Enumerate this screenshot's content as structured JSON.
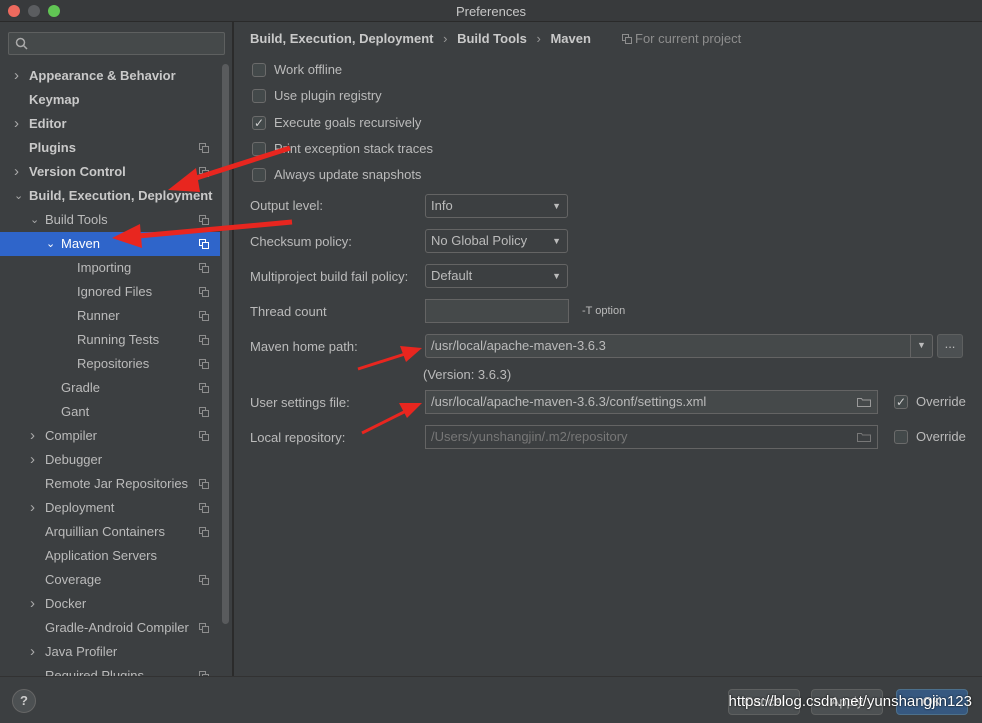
{
  "window": {
    "title": "Preferences"
  },
  "search": {
    "placeholder": ""
  },
  "sidebar": {
    "items": [
      {
        "label": "Appearance & Behavior",
        "bold": true,
        "chevron": "right",
        "copy": false
      },
      {
        "label": "Keymap",
        "bold": true,
        "chevron": "",
        "copy": false
      },
      {
        "label": "Editor",
        "bold": true,
        "chevron": "right",
        "copy": false
      },
      {
        "label": "Plugins",
        "bold": true,
        "chevron": "",
        "copy": true
      },
      {
        "label": "Version Control",
        "bold": true,
        "chevron": "right",
        "copy": true
      },
      {
        "label": "Build, Execution, Deployment",
        "bold": true,
        "chevron": "down",
        "copy": false
      },
      {
        "label": "Build Tools",
        "bold": false,
        "chevron": "down",
        "copy": true
      },
      {
        "label": "Maven",
        "bold": false,
        "chevron": "down",
        "copy": true,
        "selected": true
      },
      {
        "label": "Importing",
        "bold": false,
        "chevron": "",
        "copy": true
      },
      {
        "label": "Ignored Files",
        "bold": false,
        "chevron": "",
        "copy": true
      },
      {
        "label": "Runner",
        "bold": false,
        "chevron": "",
        "copy": true
      },
      {
        "label": "Running Tests",
        "bold": false,
        "chevron": "",
        "copy": true
      },
      {
        "label": "Repositories",
        "bold": false,
        "chevron": "",
        "copy": true
      },
      {
        "label": "Gradle",
        "bold": false,
        "chevron": "",
        "copy": true
      },
      {
        "label": "Gant",
        "bold": false,
        "chevron": "",
        "copy": true
      },
      {
        "label": "Compiler",
        "bold": false,
        "chevron": "right",
        "copy": true
      },
      {
        "label": "Debugger",
        "bold": false,
        "chevron": "right",
        "copy": false
      },
      {
        "label": "Remote Jar Repositories",
        "bold": false,
        "chevron": "",
        "copy": true
      },
      {
        "label": "Deployment",
        "bold": false,
        "chevron": "right",
        "copy": true
      },
      {
        "label": "Arquillian Containers",
        "bold": false,
        "chevron": "",
        "copy": true
      },
      {
        "label": "Application Servers",
        "bold": false,
        "chevron": "",
        "copy": false
      },
      {
        "label": "Coverage",
        "bold": false,
        "chevron": "",
        "copy": true
      },
      {
        "label": "Docker",
        "bold": false,
        "chevron": "right",
        "copy": false
      },
      {
        "label": "Gradle-Android Compiler",
        "bold": false,
        "chevron": "",
        "copy": true
      },
      {
        "label": "Java Profiler",
        "bold": false,
        "chevron": "right",
        "copy": false
      },
      {
        "label": "Required Plugins",
        "bold": false,
        "chevron": "",
        "copy": true
      }
    ]
  },
  "breadcrumb": {
    "part1": "Build, Execution, Deployment",
    "part2": "Build Tools",
    "part3": "Maven",
    "separator": "›"
  },
  "scope_label": "For current project",
  "checkboxes": [
    {
      "label": "Work offline",
      "checked": false
    },
    {
      "label": "Use plugin registry",
      "checked": false
    },
    {
      "label": "Execute goals recursively",
      "checked": true
    },
    {
      "label": "Print exception stack traces",
      "checked": false
    },
    {
      "label": "Always update snapshots",
      "checked": false
    }
  ],
  "form": {
    "output_level_label": "Output level:",
    "output_level_value": "Info",
    "checksum_label": "Checksum policy:",
    "checksum_value": "No Global Policy",
    "multiproject_label": "Multiproject build fail policy:",
    "multiproject_value": "Default",
    "thread_count_label": "Thread count",
    "thread_count_value": "",
    "thread_hint": "-T option",
    "maven_home_label": "Maven home path:",
    "maven_home_value": "/usr/local/apache-maven-3.6.3",
    "browse_label": "...",
    "version_text": "(Version: 3.6.3)",
    "settings_label": "User settings file:",
    "settings_value": "/usr/local/apache-maven-3.6.3/conf/settings.xml",
    "settings_override_label": "Override",
    "settings_override_checked": true,
    "repo_label": "Local repository:",
    "repo_value": "/Users/yunshangjin/.m2/repository",
    "repo_override_label": "Override",
    "repo_override_checked": false
  },
  "footer": {
    "help_label": "?",
    "cancel_label": "Cancel",
    "apply_label": "Apply",
    "ok_label": "OK",
    "watermark": "https://blog.csdn.net/yunshangjin123"
  },
  "colors": {
    "accent": "#2f65ca",
    "annotation": "#e8261f",
    "primary_button": "#365880"
  }
}
